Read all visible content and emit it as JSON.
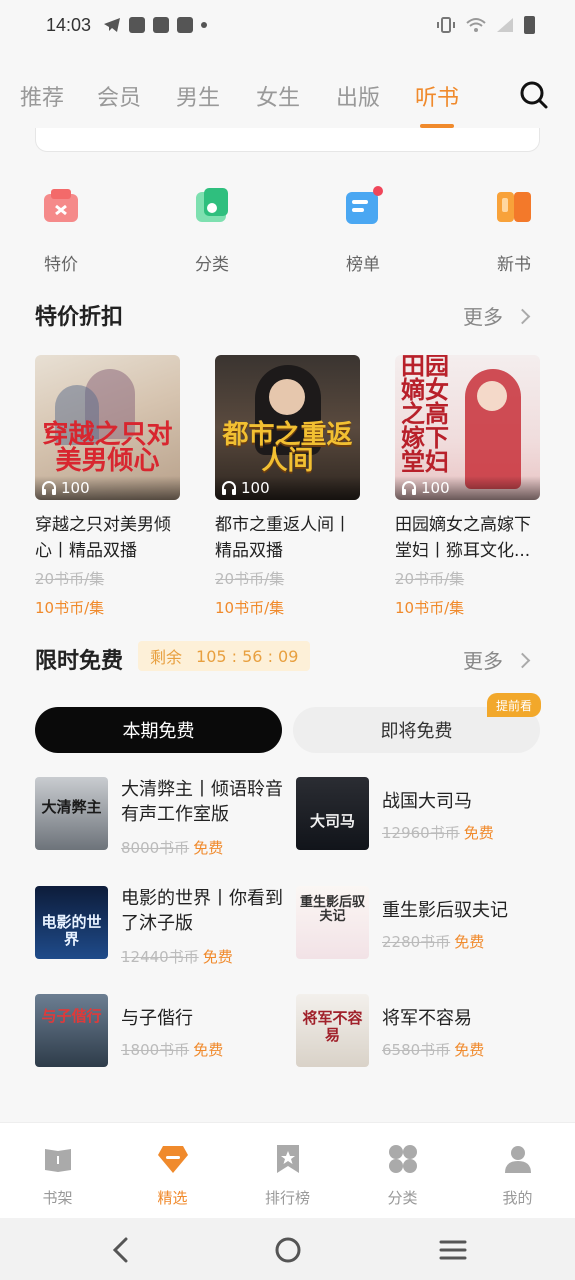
{
  "status_bar": {
    "time": "14:03"
  },
  "top_tabs": [
    {
      "label": "推荐",
      "active": false
    },
    {
      "label": "会员",
      "active": false
    },
    {
      "label": "男生",
      "active": false
    },
    {
      "label": "女生",
      "active": false
    },
    {
      "label": "出版",
      "active": false
    },
    {
      "label": "听书",
      "active": true
    }
  ],
  "quick_nav": [
    {
      "label": "特价",
      "icon": "price-tag-icon"
    },
    {
      "label": "分类",
      "icon": "category-icon"
    },
    {
      "label": "榜单",
      "icon": "ranking-icon"
    },
    {
      "label": "新书",
      "icon": "new-book-icon"
    }
  ],
  "discount_section": {
    "title": "特价折扣",
    "more": "更多",
    "books": [
      {
        "title": "穿越之只对美男倾心丨精品双播",
        "listens": "100",
        "old_price": "20书币/集",
        "new_price": "10书币/集",
        "cover_text": "穿越之只对美男倾心"
      },
      {
        "title": "都市之重返人间丨精品双播",
        "listens": "100",
        "old_price": "20书币/集",
        "new_price": "10书币/集",
        "cover_text": "都市之重返人间"
      },
      {
        "title": "田园嫡女之高嫁下堂妇丨猕耳文化...",
        "listens": "100",
        "old_price": "20书币/集",
        "new_price": "10书币/集",
        "cover_text": "田园嫡女之高嫁下堂妇"
      }
    ]
  },
  "free_section": {
    "title": "限时免费",
    "countdown_label": "剩余",
    "countdown_time": "105 : 56 : 09",
    "more": "更多",
    "tab_current": "本期免费",
    "tab_upcoming": "即将免费",
    "early_badge": "提前看",
    "books": [
      {
        "title": "大清弊主丨倾语聆音有声工作室版",
        "old_price": "8000书币",
        "free": "免费",
        "cover_text": "大清弊主"
      },
      {
        "title": "战国大司马",
        "old_price": "12960书币",
        "free": "免费",
        "cover_text": "大司马"
      },
      {
        "title": "电影的世界丨你看到了沐子版",
        "old_price": "12440书币",
        "free": "免费",
        "cover_text": "电影的世界"
      },
      {
        "title": "重生影后驭夫记",
        "old_price": "2280书币",
        "free": "免费",
        "cover_text": "重生影后驭夫记"
      },
      {
        "title": "与子偕行",
        "old_price": "1800书币",
        "free": "免费",
        "cover_text": "与子偕行"
      },
      {
        "title": "将军不容易",
        "old_price": "6580书币",
        "free": "免费",
        "cover_text": "将军不容易"
      }
    ]
  },
  "bottom_nav": [
    {
      "label": "书架",
      "icon": "bookshelf-icon",
      "active": false
    },
    {
      "label": "精选",
      "icon": "featured-icon",
      "active": true
    },
    {
      "label": "排行榜",
      "icon": "ranking-bookmark-icon",
      "active": false
    },
    {
      "label": "分类",
      "icon": "grid-icon",
      "active": false
    },
    {
      "label": "我的",
      "icon": "profile-icon",
      "active": false
    }
  ],
  "colors": {
    "accent": "#f08a2c",
    "badge": "#f2a82b"
  }
}
